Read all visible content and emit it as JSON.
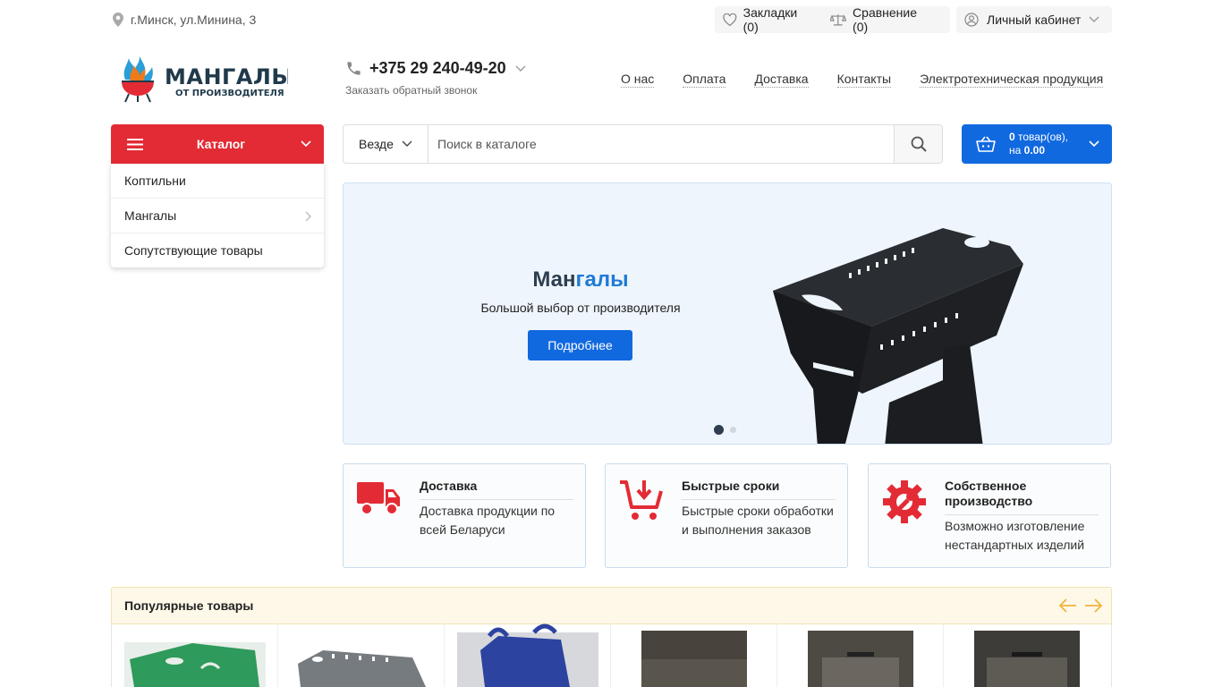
{
  "topbar": {
    "location": "г.Минск, ул.Минина, 3",
    "bookmarks": "Закладки (0)",
    "compare": "Сравнение (0)",
    "account": "Личный кабинет"
  },
  "header": {
    "logo_line1": "МАНГАЛЫ",
    "logo_line2": "ОТ ПРОИЗВОДИТЕЛЯ",
    "phone": "+375 29 240-49-20",
    "callback": "Заказать обратный звонок",
    "nav": [
      "О нас",
      "Оплата",
      "Доставка",
      "Контакты",
      "Электротехническая продукция"
    ]
  },
  "catalog": {
    "button": "Каталог",
    "items": [
      {
        "label": "Коптильни"
      },
      {
        "label": "Мангалы"
      },
      {
        "label": "Сопутствующие товары"
      }
    ]
  },
  "search": {
    "scope": "Везде",
    "placeholder": "Поиск в каталоге"
  },
  "cart": {
    "count": "0",
    "count_suffix": " товар(ов),",
    "sum_prefix": "на ",
    "sum": "0.00"
  },
  "banner": {
    "title_a": "Ман",
    "title_b": "галы",
    "subtitle": "Большой выбор от производителя",
    "button": "Подробнее",
    "slides": 2,
    "active_slide": 1
  },
  "features": [
    {
      "title": "Доставка",
      "desc": "Доставка продукции по всей Беларуси",
      "icon": "truck-icon"
    },
    {
      "title": "Быстрые сроки",
      "desc": "Быстрые сроки обработки и выполнения заказов",
      "icon": "cart-download-icon"
    },
    {
      "title": "Собственное производство",
      "desc": "Возможно изготовление нестандартных изделий",
      "icon": "gear-wrench-icon"
    }
  ],
  "popular": {
    "title": "Популярные товары"
  },
  "colors": {
    "brand_red": "#e32b35",
    "brand_blue": "#1169e0"
  }
}
